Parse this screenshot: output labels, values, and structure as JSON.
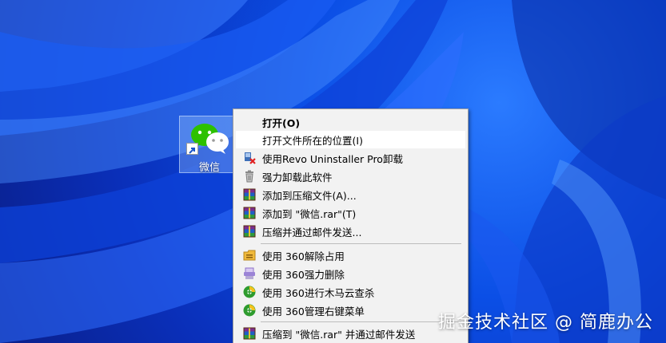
{
  "desktop": {
    "icon_label": "微信",
    "icon": "wechat-icon"
  },
  "context_menu": {
    "items": [
      {
        "label": "打开(O)",
        "icon": "none",
        "bold": true
      },
      {
        "label": "打开文件所在的位置(I)",
        "icon": "none",
        "hover": true
      },
      {
        "label": "使用Revo Uninstaller Pro卸载",
        "icon": "revo-uninstaller-icon"
      },
      {
        "label": "强力卸载此软件",
        "icon": "trash-icon"
      },
      {
        "label": "添加到压缩文件(A)...",
        "icon": "winrar-icon"
      },
      {
        "label": "添加到 \"微信.rar\"(T)",
        "icon": "winrar-icon"
      },
      {
        "label": "压缩并通过邮件发送...",
        "icon": "winrar-icon"
      },
      {
        "label": "使用 360解除占用",
        "icon": "unlock-360-icon"
      },
      {
        "label": "使用 360强力删除",
        "icon": "shred-360-icon"
      },
      {
        "label": "使用 360进行木马云查杀",
        "icon": "360-security-icon"
      },
      {
        "label": "使用 360管理右键菜单",
        "icon": "360-security-icon"
      },
      {
        "label": "压缩到 \"微信.rar\" 并通过邮件发送",
        "icon": "winrar-icon"
      }
    ]
  },
  "watermark": "掘金技术社区 @ 简鹿办公"
}
